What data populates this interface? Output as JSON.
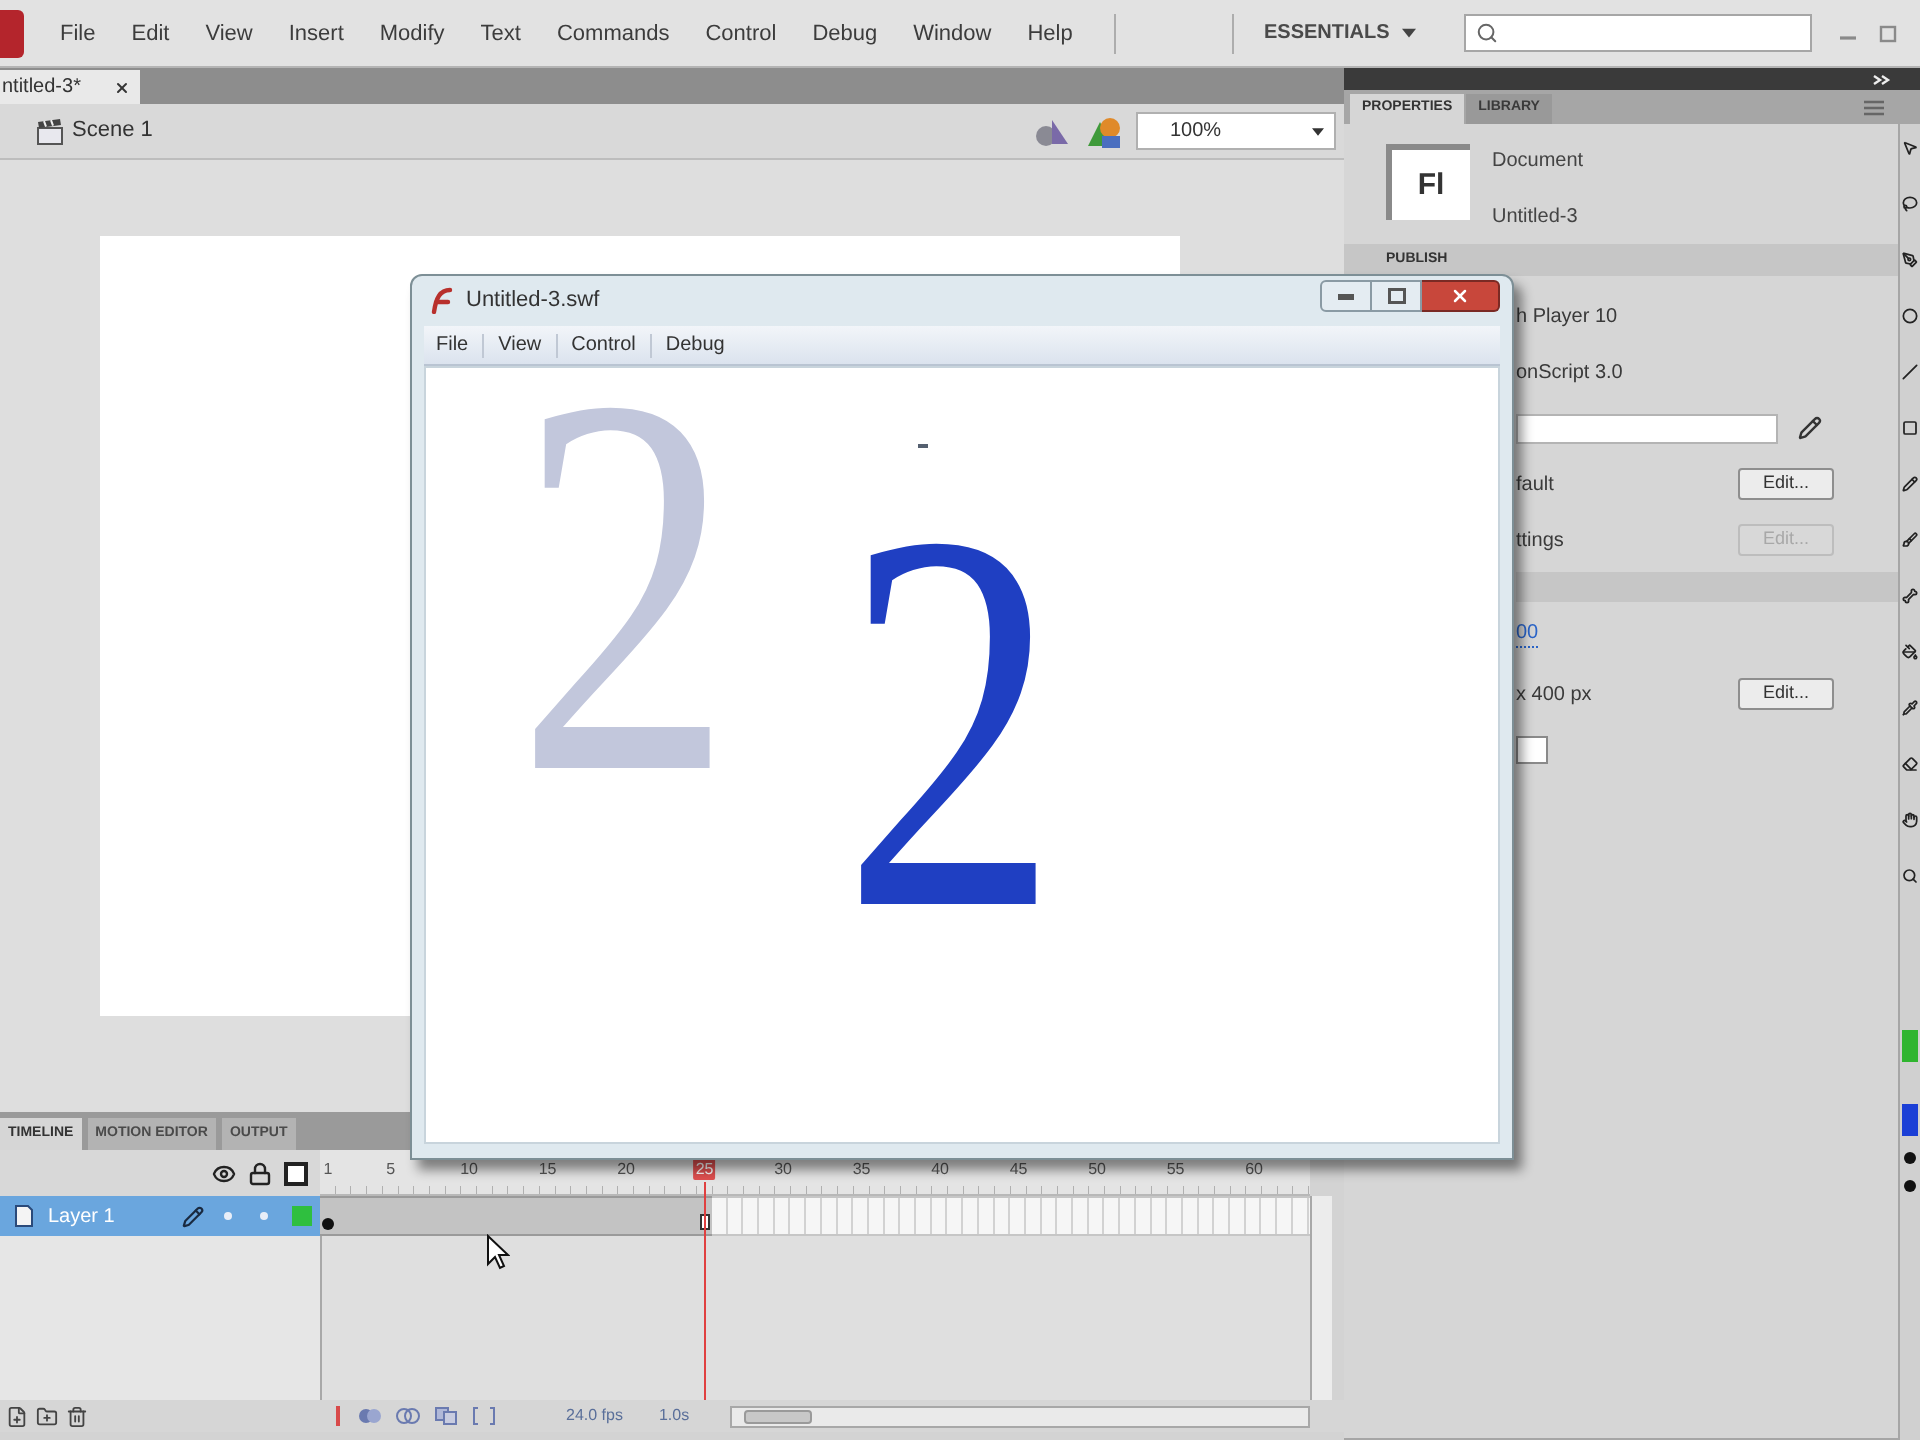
{
  "menu_bar": {
    "items": [
      "File",
      "Edit",
      "View",
      "Insert",
      "Modify",
      "Text",
      "Commands",
      "Control",
      "Debug",
      "Window",
      "Help"
    ],
    "workspace": "ESSENTIALS"
  },
  "document_tabs": [
    {
      "label": "ntitled-3*",
      "selected": true
    }
  ],
  "edit_bar": {
    "scene": "Scene 1",
    "zoom": "100%"
  },
  "timeline": {
    "tabs": [
      {
        "label": "TIMELINE",
        "selected": true
      },
      {
        "label": "MOTION EDITOR",
        "selected": false
      },
      {
        "label": "OUTPUT",
        "selected": false
      }
    ],
    "frame_labels": [
      {
        "label": "1",
        "selected": false
      },
      {
        "label": "5",
        "selected": false
      },
      {
        "label": "10",
        "selected": false
      },
      {
        "label": "15",
        "selected": false
      },
      {
        "label": "20",
        "selected": false
      },
      {
        "label": "25",
        "selected": true
      },
      {
        "label": "30",
        "selected": false
      },
      {
        "label": "35",
        "selected": false
      },
      {
        "label": "40",
        "selected": false
      },
      {
        "label": "45",
        "selected": false
      },
      {
        "label": "50",
        "selected": false
      },
      {
        "label": "55",
        "selected": false
      },
      {
        "label": "60",
        "selected": false
      }
    ],
    "layers": [
      {
        "name": "Layer 1",
        "selected": true,
        "color": "#2fbf3f"
      }
    ],
    "fps": "24.0 fps",
    "time": "1.0s"
  },
  "properties_panel": {
    "tabs": [
      {
        "label": "PROPERTIES",
        "selected": true
      },
      {
        "label": "LIBRARY",
        "selected": false
      }
    ],
    "document_icon": "Fl",
    "document_type": "Document",
    "document_name": "Untitled-3",
    "section": "PUBLISH",
    "rows": [
      {
        "kind": "text",
        "text": "h Player 10"
      },
      {
        "kind": "text",
        "text": "onScript 3.0"
      },
      {
        "kind": "field"
      },
      {
        "kind": "text",
        "text": "fault",
        "button": {
          "label": "Edit...",
          "disabled": false
        }
      },
      {
        "kind": "text",
        "text": "ttings",
        "button": {
          "label": "Edit...",
          "disabled": true
        }
      },
      {
        "kind": "section"
      },
      {
        "kind": "value",
        "text": "00"
      },
      {
        "kind": "text",
        "text": "x 400 px",
        "button": {
          "label": "Edit...",
          "disabled": false
        }
      },
      {
        "kind": "swatch",
        "color": "#ffffff"
      }
    ]
  },
  "tools": {
    "swatches": [
      {
        "color": "#2fb52f"
      },
      {
        "color": "#1b3fd6"
      }
    ]
  },
  "player_window": {
    "title": "Untitled-3.swf",
    "menu": [
      "File",
      "View",
      "Control",
      "Debug"
    ],
    "content": [
      {
        "kind": "ghost",
        "text": "2"
      },
      {
        "kind": "current",
        "text": "2"
      }
    ]
  }
}
